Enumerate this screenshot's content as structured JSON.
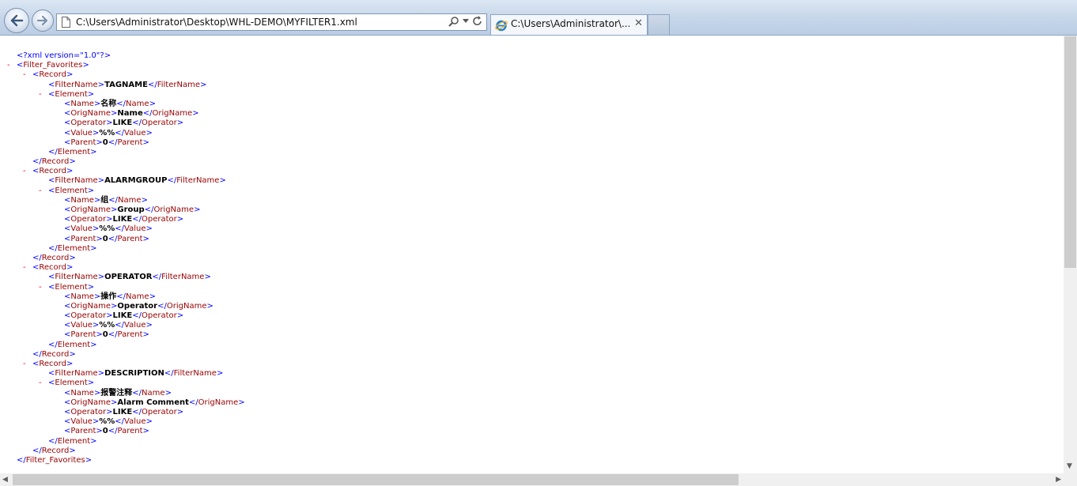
{
  "browser": {
    "address": "C:\\Users\\Administrator\\Desktop\\WHL-DEMO\\MYFILTER1.xml",
    "tab_title": "C:\\Users\\Administrator\\...",
    "tab_close": "✕"
  },
  "xml": {
    "declaration": "<?xml version=\"1.0\"?>",
    "root": "Filter_Favorites",
    "records": [
      {
        "filter_name": "TAGNAME",
        "name": "名称",
        "orig_name": "Name",
        "operator": "LIKE",
        "value": "%%",
        "parent": "0"
      },
      {
        "filter_name": "ALARMGROUP",
        "name": "组",
        "orig_name": "Group",
        "operator": "LIKE",
        "value": "%%",
        "parent": "0"
      },
      {
        "filter_name": "OPERATOR",
        "name": "操作",
        "orig_name": "Operator",
        "operator": "LIKE",
        "value": "%%",
        "parent": "0"
      },
      {
        "filter_name": "DESCRIPTION",
        "name": "报警注释",
        "orig_name": "Alarm Comment",
        "operator": "LIKE",
        "value": "%%",
        "parent": "0"
      }
    ]
  },
  "colors": {
    "tag_bracket": "#0000ff",
    "tag_name": "#990000",
    "text": "#000000",
    "collapse_minus": "#ff0000"
  }
}
